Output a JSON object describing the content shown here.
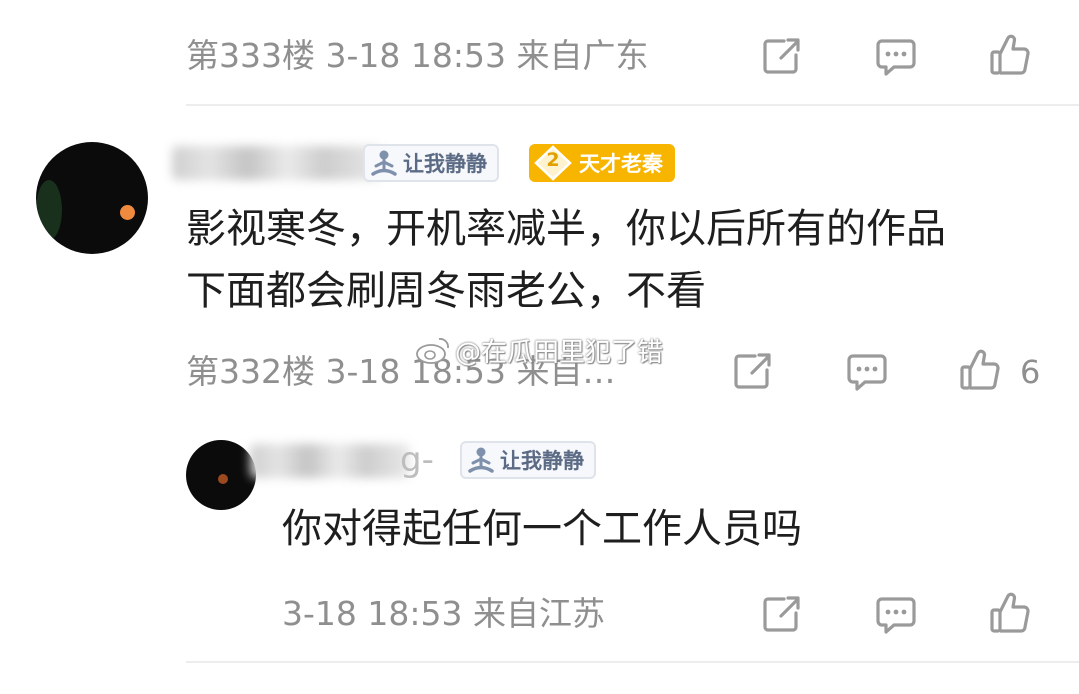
{
  "colors": {
    "meta_text": "#8f8f8f",
    "body_text": "#1e1e1e",
    "gold_badge": "#f7b500",
    "badge_text": "#5c6b85"
  },
  "comment_333": {
    "meta": "第333楼  3-18 18:53  来自广东",
    "share_icon": "share-icon",
    "reply_icon": "comment-icon",
    "like_icon": "thumbs-up-icon"
  },
  "comment_332": {
    "badge_label": "让我静静",
    "gold_badge_level": "2",
    "gold_badge_label": "天才老秦",
    "text_line1": "影视寒冬，开机率减半，你以后所有的作品",
    "text_line2": "下面都会刷周冬雨老公，不看",
    "meta": "第332楼  3-18 18:53  来自…",
    "like_count": "6"
  },
  "reply": {
    "name_suffix": "g-",
    "badge_label": "让我静静",
    "text": "你对得起任何一个工作人员吗",
    "meta": "3-18 18:53  来自江苏"
  },
  "watermark": "@在瓜田里犯了错"
}
